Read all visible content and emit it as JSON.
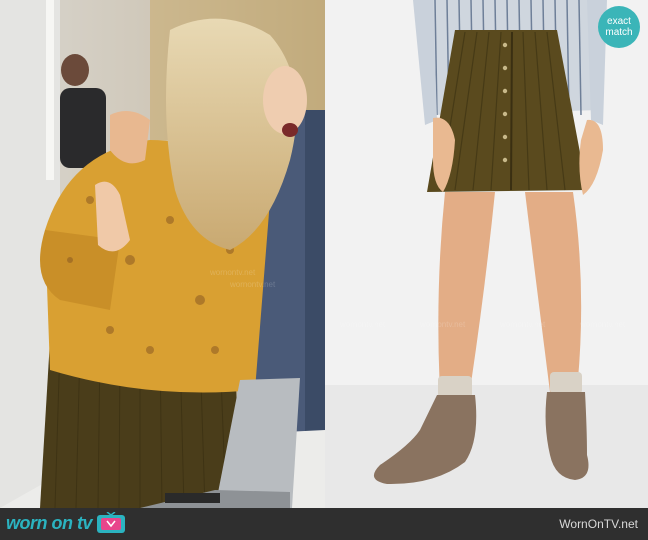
{
  "badge": {
    "line1": "exact",
    "line2": "match"
  },
  "footer": {
    "logo_text": "worn on tv",
    "site": "WornOnTV.net"
  },
  "watermark": "wornontv.net",
  "icons": {
    "logo": "tv-icon"
  },
  "colors": {
    "accent": "#3bb5b8",
    "footer_bg": "#2f2f2f",
    "skirt": "#5a4a1e",
    "blouse": "#d9a032"
  }
}
